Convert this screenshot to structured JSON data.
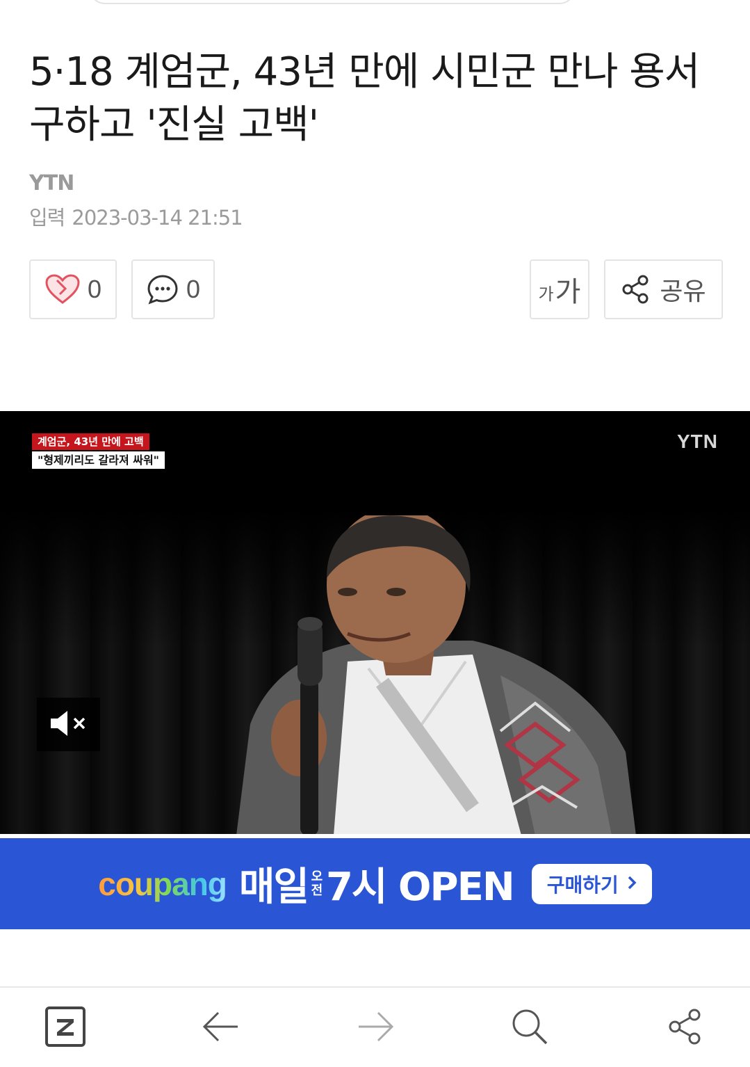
{
  "article": {
    "headline": "5·18 계엄군, 43년 만에 시민군 만나 용서 구하고 '진실 고백'",
    "press": "YTN",
    "date_label": "입력",
    "date_value": "2023-03-14 21:51"
  },
  "actions": {
    "like_count": "0",
    "comment_count": "0",
    "font_small": "가",
    "font_large": "가",
    "share_label": "공유"
  },
  "video": {
    "caption_line1": "계엄군, 43년 만에 고백",
    "caption_line2": "\"형제끼리도 갈라져 싸워\"",
    "channel_logo": "YTN",
    "muted": true
  },
  "ad": {
    "brand": "coupang",
    "text_main": "매일",
    "text_small": "오전",
    "text_time": "7시 OPEN",
    "cta": "구매하기",
    "bg_color": "#2a56d6"
  },
  "bottom_nav": {
    "home_icon": "z-logo-icon",
    "back_icon": "arrow-left-icon",
    "forward_icon": "arrow-right-icon",
    "search_icon": "search-icon",
    "share_icon": "share-icon"
  }
}
